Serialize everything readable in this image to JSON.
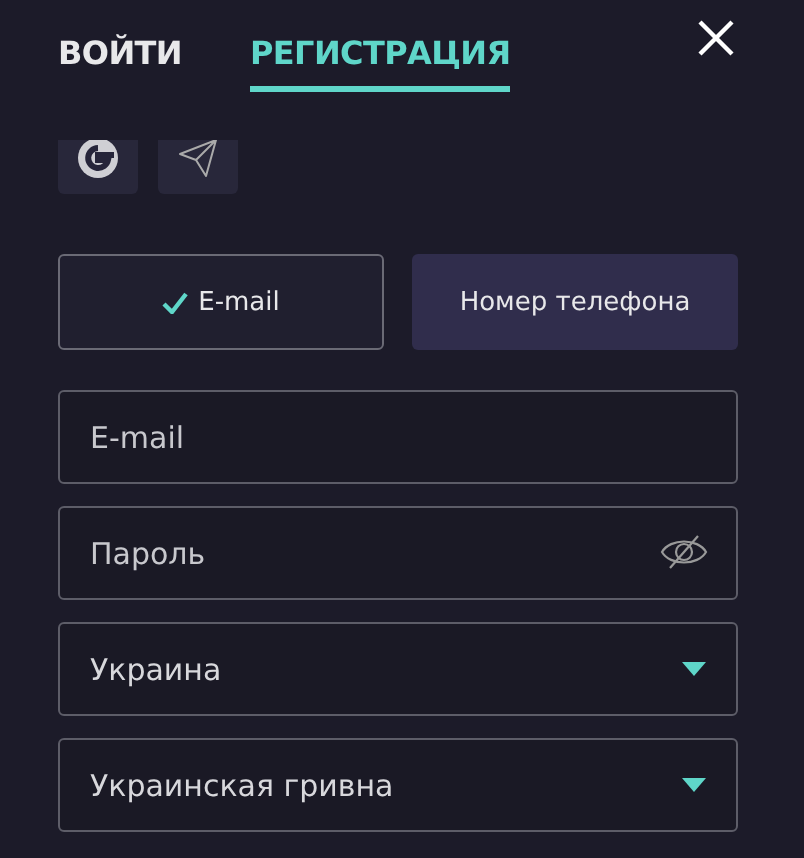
{
  "tabs": [
    {
      "label": "ВОЙТИ",
      "selected": false
    },
    {
      "label": "РЕГИСТРАЦИЯ",
      "selected": true
    }
  ],
  "social": [
    {
      "kind": "google"
    },
    {
      "kind": "telegram"
    }
  ],
  "methods": [
    {
      "label": "E-mail",
      "selected": true
    },
    {
      "label": "Номер телефона",
      "selected": false
    }
  ],
  "fields": [
    {
      "kind": "text",
      "placeholder": "E-mail"
    },
    {
      "kind": "password",
      "placeholder": "Пароль"
    },
    {
      "kind": "select",
      "value": "Украина"
    },
    {
      "kind": "select",
      "value": "Украинская гривна"
    }
  ]
}
